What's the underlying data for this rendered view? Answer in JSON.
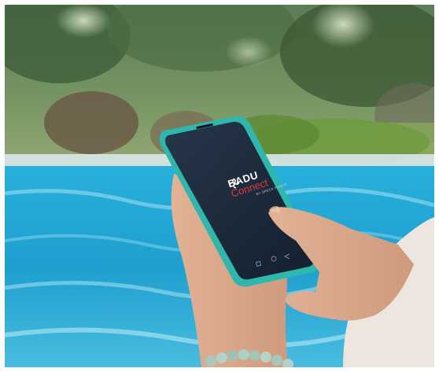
{
  "app": {
    "brand_name": "BADU",
    "brand_product": "Connect",
    "brand_tagline": "BY SPECK PUMPS"
  },
  "icons": {
    "brand_logo": "swirl-icon"
  },
  "colors": {
    "pool_water": "#1d9fd0",
    "phone_frame": "#2fb6ad",
    "screen": "#1c2a3b",
    "accent_red": "#e23a3a"
  }
}
